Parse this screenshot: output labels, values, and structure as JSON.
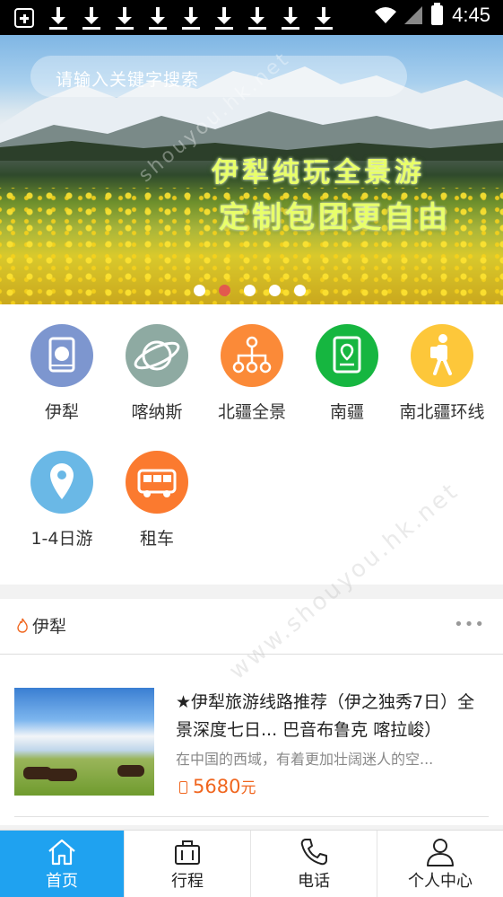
{
  "status_bar": {
    "time": "4:45",
    "left_icons": [
      "app-icon",
      "download-icon",
      "download-icon",
      "download-icon",
      "download-icon",
      "download-icon",
      "download-icon",
      "download-icon",
      "download-icon",
      "download-icon"
    ],
    "right_icons": [
      "wifi-icon",
      "signal-icon",
      "battery-charging-icon"
    ]
  },
  "banner": {
    "search_placeholder": "请输入关键字搜索",
    "slogan_line1": "伊犁纯玩全景游",
    "slogan_line2": "定制包团更自由",
    "slide_count": 5,
    "active_slide": 2,
    "watermark": "shouyou.hk.net"
  },
  "categories": [
    {
      "label": "伊犁",
      "icon": "book-icon",
      "color": "#7d96cf"
    },
    {
      "label": "喀纳斯",
      "icon": "orbit-icon",
      "color": "#8eaaa2"
    },
    {
      "label": "北疆全景",
      "icon": "network-icon",
      "color": "#fb8a38"
    },
    {
      "label": "南疆",
      "icon": "guidebook-icon",
      "color": "#16b640"
    },
    {
      "label": "南北疆环线",
      "icon": "hiker-icon",
      "color": "#fdc73a"
    },
    {
      "label": "1-4日游",
      "icon": "location-pin-icon",
      "color": "#6ab8e6"
    },
    {
      "label": "租车",
      "icon": "bus-icon",
      "color": "#fb7a2f"
    }
  ],
  "section": {
    "title": "伊犁",
    "more": "•••"
  },
  "list": [
    {
      "title": "★伊犁旅游线路推荐（伊之独秀7日）全景深度七日... 巴音布鲁克 喀拉峻）",
      "desc": "在中国的西域，有着更加壮阔迷人的空...",
      "price": "5680",
      "price_unit": "元"
    }
  ],
  "nav": {
    "tabs": [
      {
        "label": "首页",
        "icon": "home-icon",
        "active": true
      },
      {
        "label": "行程",
        "icon": "luggage-icon",
        "active": false
      },
      {
        "label": "电话",
        "icon": "phone-icon",
        "active": false
      },
      {
        "label": "个人中心",
        "icon": "person-icon",
        "active": false
      }
    ]
  },
  "watermark": "www.shouyou.hk.net",
  "colors": {
    "accent": "#1fa2f0",
    "price": "#f0661f",
    "active_dot": "#e25a4e"
  }
}
